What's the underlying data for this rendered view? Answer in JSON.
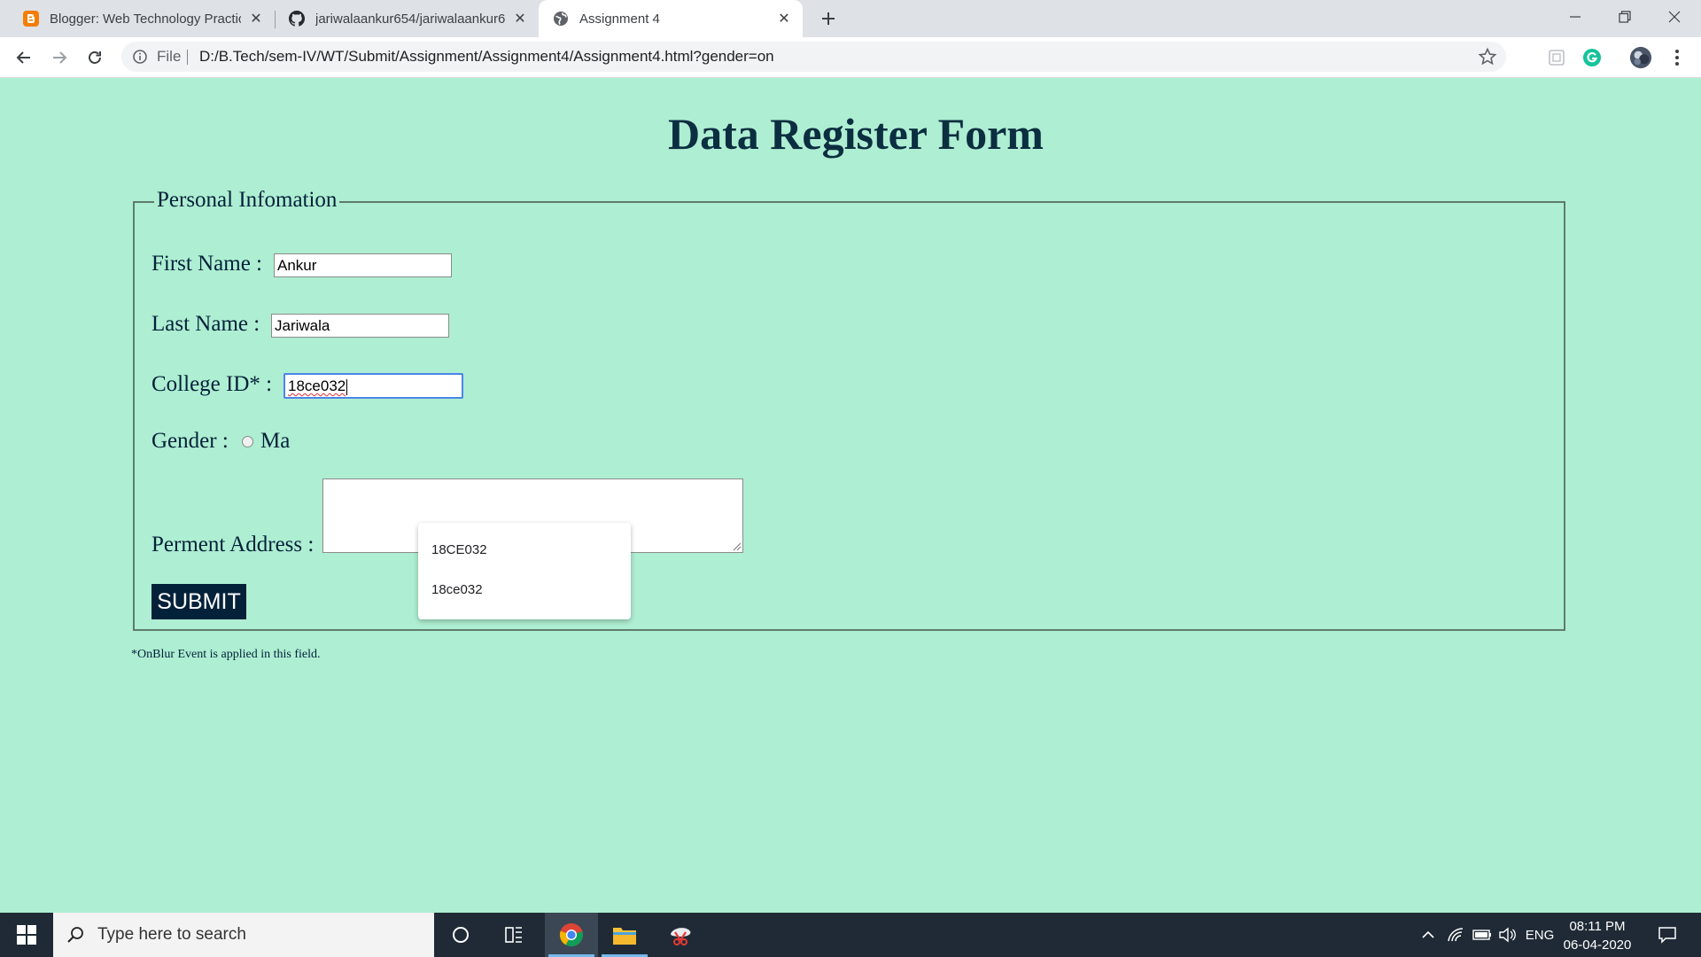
{
  "browser": {
    "tabs": [
      {
        "title": "Blogger: Web Technology Practic",
        "icon": "blogger-icon",
        "active": false
      },
      {
        "title": "jariwalaankur654/jariwalaankur65",
        "icon": "github-icon",
        "active": false
      },
      {
        "title": "Assignment 4",
        "icon": "globe-icon",
        "active": true
      }
    ],
    "address": {
      "scheme_label": "File",
      "url": "D:/B.Tech/sem-IV/WT/Submit/Assignment/Assignment4/Assignment4.html?gender=on"
    }
  },
  "page": {
    "heading": "Data Register Form",
    "legend": "Personal Infomation",
    "fields": {
      "first_name": {
        "label": "First Name :",
        "value": "Ankur"
      },
      "last_name": {
        "label": "Last Name :",
        "value": "Jariwala"
      },
      "college_id": {
        "label": "College ID* :",
        "value": "18ce032"
      },
      "gender": {
        "label": "Gender :",
        "option_partial": "Ma"
      },
      "address": {
        "label": "Perment Address :",
        "value": ""
      }
    },
    "autocomplete": [
      "18CE032",
      "18ce032"
    ],
    "submit_label": "SUBMIT",
    "note": "*OnBlur Event is applied in this field."
  },
  "taskbar": {
    "search_placeholder": "Type here to search",
    "language": "ENG",
    "time": "08:11 PM",
    "date": "06-04-2020"
  },
  "colors": {
    "page_background": "#aeeed2",
    "text_dark": "#04213a",
    "submit_background": "#04213a",
    "focus_border": "#4a86e8"
  }
}
